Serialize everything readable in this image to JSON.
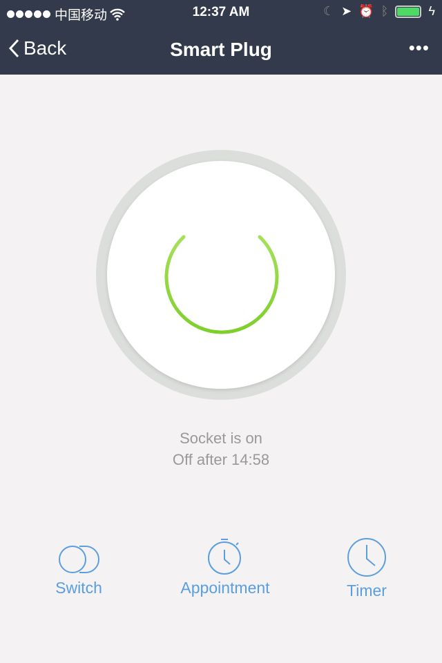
{
  "status_bar": {
    "carrier": "中国移动",
    "time": "12:37 AM"
  },
  "nav": {
    "back_label": "Back",
    "title": "Smart Plug",
    "more_label": "•••"
  },
  "power": {
    "state": "on",
    "accent": "#8ed93a"
  },
  "status": {
    "line1": "Socket is on",
    "line2": "Off after 14:58"
  },
  "actions": [
    {
      "label": "Switch",
      "icon": "switch-icon"
    },
    {
      "label": "Appointment",
      "icon": "stopwatch-icon"
    },
    {
      "label": "Timer",
      "icon": "clock-icon"
    }
  ],
  "colors": {
    "nav_bg": "#323a4b",
    "action": "#5b9ee0"
  }
}
